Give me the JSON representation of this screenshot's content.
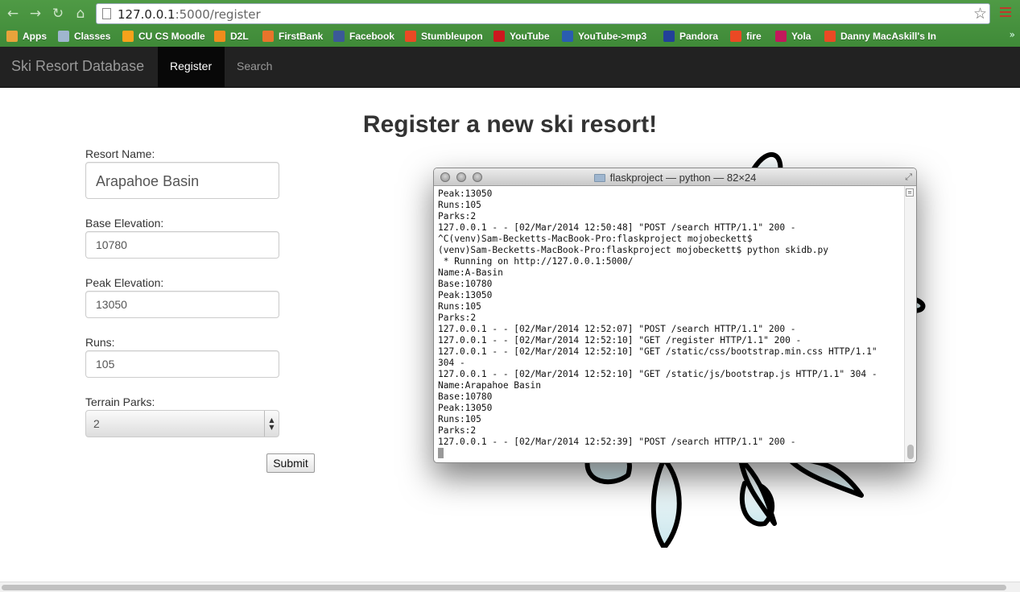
{
  "browser": {
    "url_host": "127.0.0.1",
    "url_rest": ":5000/register",
    "bookmarks": [
      {
        "label": "Apps",
        "icon": "apps-grid-icon",
        "color": "#e8a33b"
      },
      {
        "label": "Classes",
        "icon": "folder-icon",
        "color": "#9fb6cf"
      },
      {
        "label": "CU CS Moodle",
        "icon": "moodle-icon",
        "color": "#f7a21b"
      },
      {
        "label": "D2L",
        "icon": "d2l-icon",
        "color": "#f08c1c"
      },
      {
        "label": "FirstBank",
        "icon": "firstbank-icon",
        "color": "#e8742b"
      },
      {
        "label": "Facebook",
        "icon": "facebook-icon",
        "color": "#3b5998"
      },
      {
        "label": "Stumbleupon",
        "icon": "stumbleupon-icon",
        "color": "#eb4924"
      },
      {
        "label": "YouTube",
        "icon": "youtube-icon",
        "color": "#cc181e"
      },
      {
        "label": "YouTube->mp3",
        "icon": "ytmp3-icon",
        "color": "#2a5db0"
      },
      {
        "label": "Pandora",
        "icon": "pandora-icon",
        "color": "#224099"
      },
      {
        "label": "fire",
        "icon": "stumbleupon-icon",
        "color": "#eb4924"
      },
      {
        "label": "Yola",
        "icon": "yola-icon",
        "color": "#c2185b"
      },
      {
        "label": "Danny MacAskill's In",
        "icon": "stumbleupon-icon",
        "color": "#eb4924"
      }
    ]
  },
  "navbar": {
    "brand": "Ski Resort Database",
    "register": "Register",
    "search": "Search"
  },
  "form": {
    "title": "Register a new ski resort!",
    "resort_name_label": "Resort Name:",
    "resort_name_value": "Arapahoe Basin",
    "base_label": "Base Elevation:",
    "base_value": "10780",
    "peak_label": "Peak Elevation:",
    "peak_value": "13050",
    "runs_label": "Runs:",
    "runs_value": "105",
    "parks_label": "Terrain Parks:",
    "parks_value": "2",
    "submit": "Submit"
  },
  "terminal": {
    "title": "flaskproject — python — 82×24",
    "lines": [
      "Peak:13050",
      "Runs:105",
      "Parks:2",
      "127.0.0.1 - - [02/Mar/2014 12:50:48] \"POST /search HTTP/1.1\" 200 -",
      "^C(venv)Sam-Becketts-MacBook-Pro:flaskproject mojobeckett$",
      "(venv)Sam-Becketts-MacBook-Pro:flaskproject mojobeckett$ python skidb.py",
      " * Running on http://127.0.0.1:5000/",
      "Name:A-Basin",
      "Base:10780",
      "Peak:13050",
      "Runs:105",
      "Parks:2",
      "127.0.0.1 - - [02/Mar/2014 12:52:07] \"POST /search HTTP/1.1\" 200 -",
      "127.0.0.1 - - [02/Mar/2014 12:52:10] \"GET /register HTTP/1.1\" 200 -",
      "127.0.0.1 - - [02/Mar/2014 12:52:10] \"GET /static/css/bootstrap.min.css HTTP/1.1\"",
      "304 -",
      "127.0.0.1 - - [02/Mar/2014 12:52:10] \"GET /static/js/bootstrap.js HTTP/1.1\" 304 -",
      "Name:Arapahoe Basin",
      "Base:10780",
      "Peak:13050",
      "Runs:105",
      "Parks:2",
      "127.0.0.1 - - [02/Mar/2014 12:52:39] \"POST /search HTTP/1.1\" 200 -"
    ]
  }
}
